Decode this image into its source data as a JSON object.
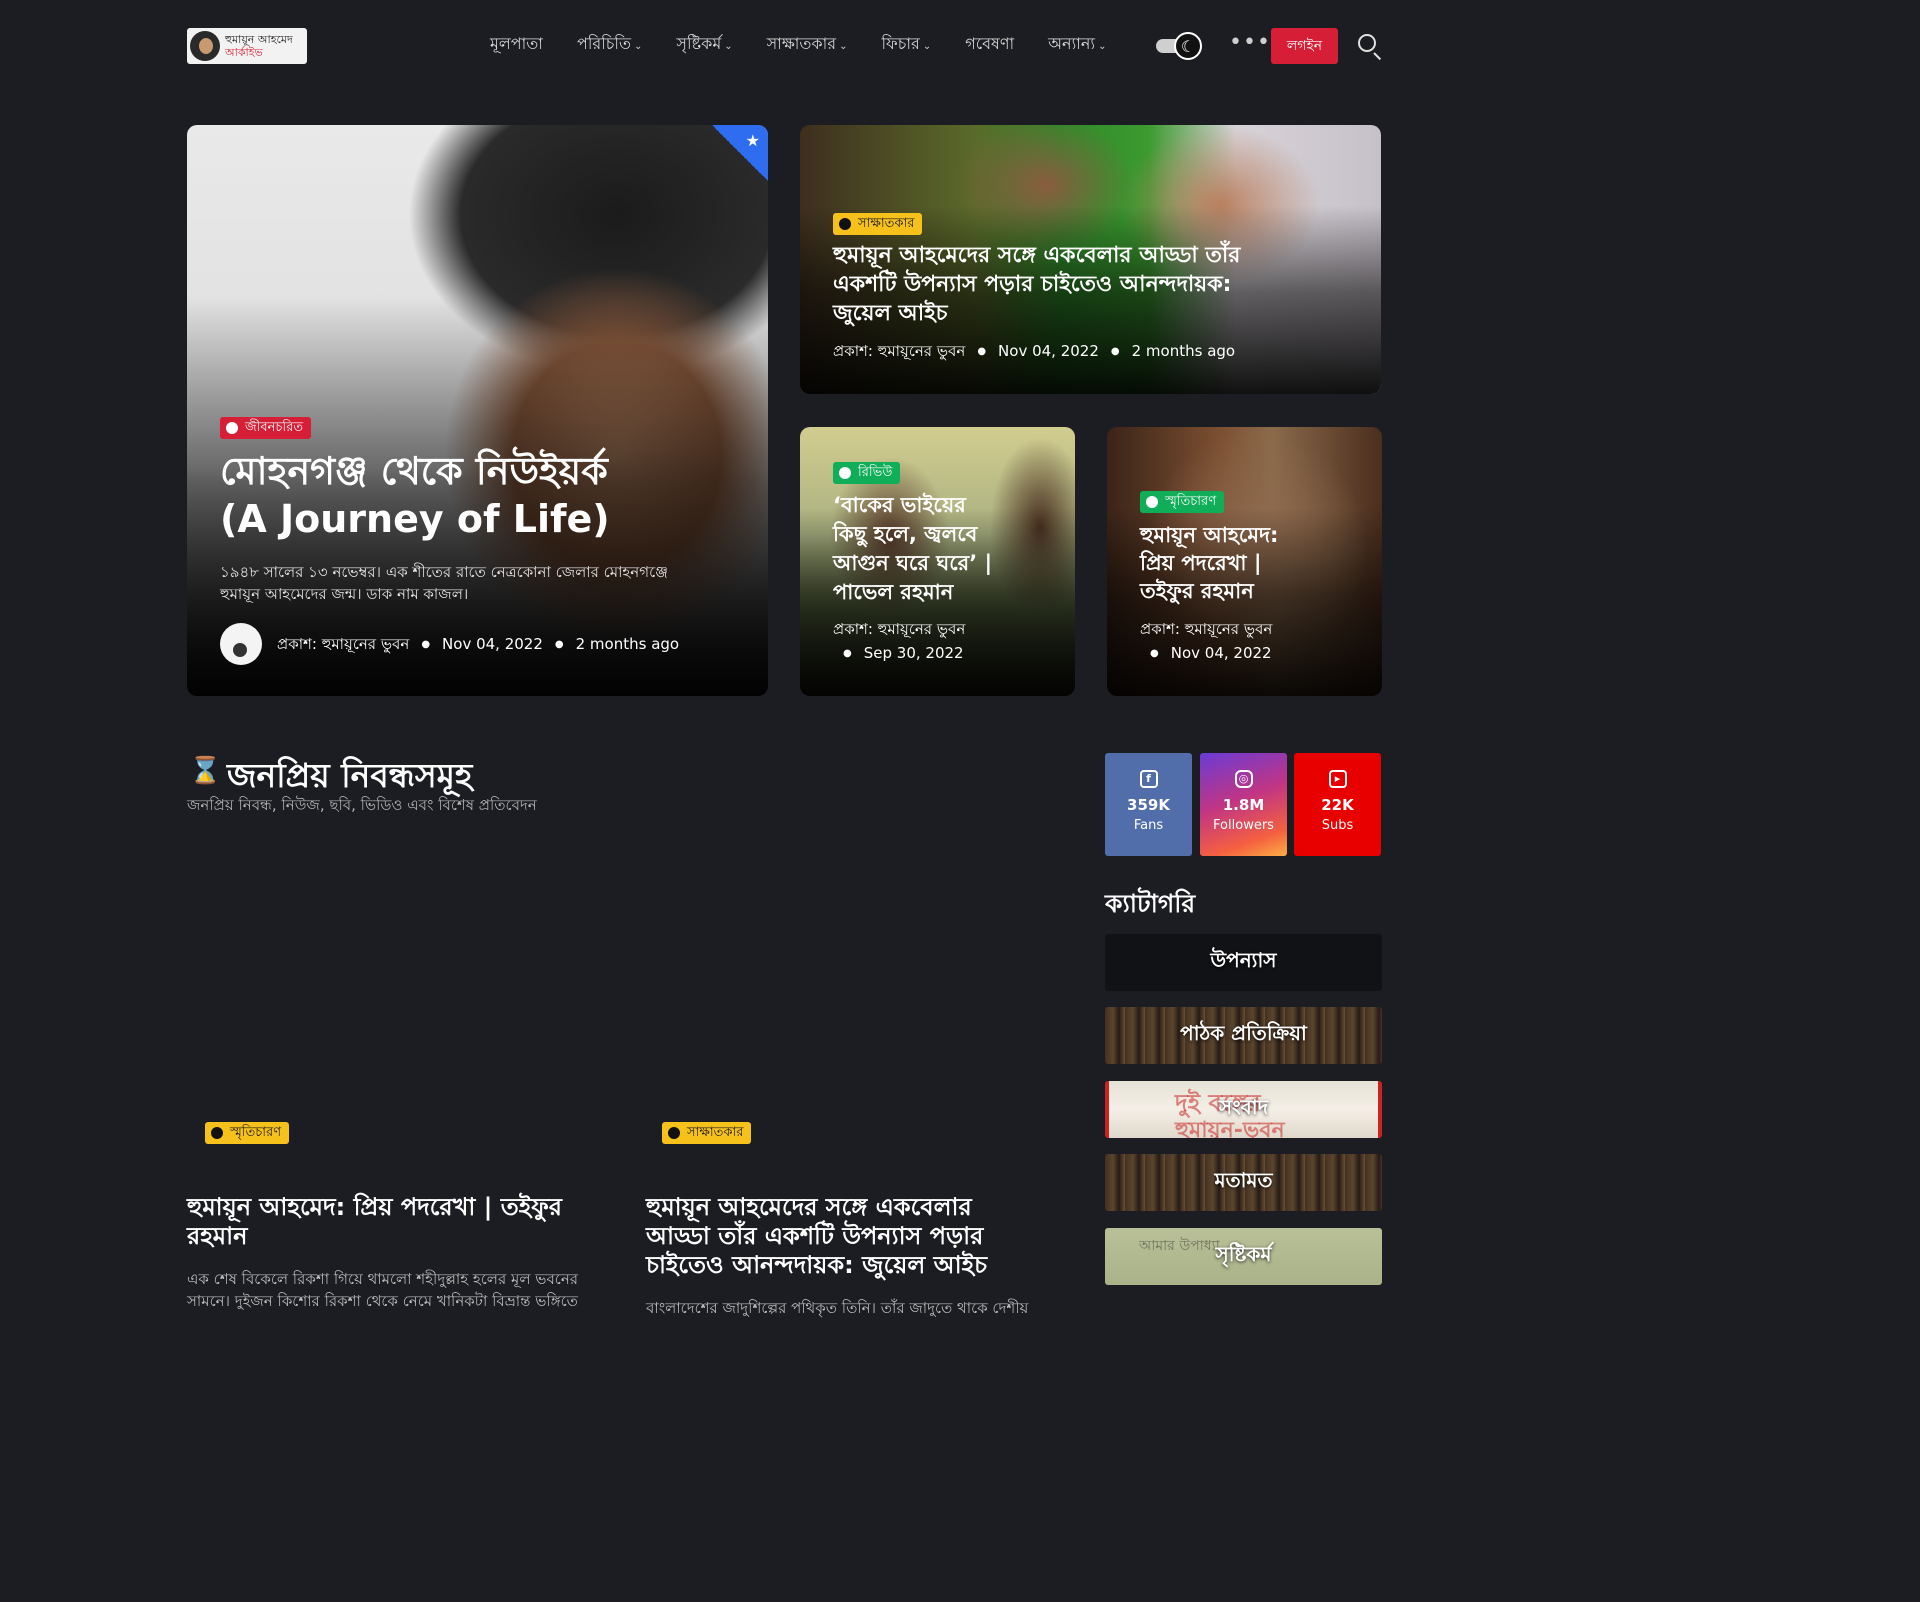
{
  "header": {
    "logo_line1": "হুমায়ূন আহমেদ",
    "logo_line2": "আর্কাইভ",
    "nav": [
      {
        "label": "মূলপাতা",
        "has_dropdown": false
      },
      {
        "label": "পরিচিতি",
        "has_dropdown": true
      },
      {
        "label": "সৃষ্টিকর্ম",
        "has_dropdown": true
      },
      {
        "label": "সাক্ষাতকার",
        "has_dropdown": true
      },
      {
        "label": "ফিচার",
        "has_dropdown": true
      },
      {
        "label": "গবেষণা",
        "has_dropdown": false
      },
      {
        "label": "অন্যান্য",
        "has_dropdown": true
      }
    ],
    "login_label": "লগইন",
    "icons": {
      "theme": "moon-icon",
      "more": "more-dots-icon",
      "search": "search-icon"
    }
  },
  "featured": {
    "main": {
      "category": "জীবনচরিত",
      "title_line1": "মোহনগঞ্জ থেকে নিউইয়র্ক",
      "title_line2": "(A Journey of Life)",
      "excerpt_line1": "১৯৪৮ সালের ১৩ নভেম্বর। এক শীতের রাতে নেত্রকোনা জেলার মোহনগঞ্জে",
      "excerpt_line2": "হুমায়ূন আহমেদের জন্ম। ডাক নাম কাজল।",
      "author": "প্রকাশ: হুমায়ূনের ভুবন",
      "date": "Nov 04, 2022",
      "ago": "2 months ago"
    },
    "top_right": {
      "category": "সাক্ষাতকার",
      "title_line1": "হুমায়ূন আহমেদের সঙ্গে একবেলার আড্ডা তাঁর",
      "title_line2": "একশটি উপন্যাস পড়ার চাইতেও আনন্দদায়ক:",
      "title_line3": "জুয়েল আইচ",
      "author": "প্রকাশ: হুমায়ূনের ভুবন",
      "date": "Nov 04, 2022",
      "ago": "2 months ago"
    },
    "bottom_left": {
      "category": "রিভিউ",
      "title_line1": "‘বাকের ভাইয়ের",
      "title_line2": "কিছু হলে, জ্বলবে",
      "title_line3": "আগুন ঘরে ঘরে’ |",
      "title_line4": "পাভেল রহমান",
      "author": "প্রকাশ: হুমায়ূনের ভুবন",
      "date": "Sep 30, 2022"
    },
    "bottom_right": {
      "category": "স্মৃতিচারণ",
      "title_line1": "হুমায়ূন আহমেদ:",
      "title_line2": "প্রিয় পদরেখা |",
      "title_line3": "তইফুর রহমান",
      "author": "প্রকাশ: হুমায়ূনের ভুবন",
      "date": "Nov 04, 2022"
    }
  },
  "section": {
    "title": "জনপ্রিয় নিবন্ধসমূহ",
    "subtitle": "জনপ্রিয় নিবন্ধ, নিউজ, ছবি, ভিডিও এবং বিশেষ প্রতিবেদন",
    "posts": [
      {
        "category": "স্মৃতিচারণ",
        "title_line1": "হুমায়ূন আহমেদ: প্রিয় পদরেখা | তইফুর",
        "title_line2": "রহমান",
        "excerpt_line1": "এক শেষ বিকেলে রিকশা গিয়ে থামলো শহীদুল্লাহ হলের মূল ভবনের",
        "excerpt_line2": "সামনে। দুইজন কিশোর রিকশা থেকে নেমে খানিকটা বিভ্রান্ত ভঙ্গিতে"
      },
      {
        "category": "সাক্ষাতকার",
        "title_line1": "হুমায়ূন আহমেদের সঙ্গে একবেলার",
        "title_line2": "আড্ডা তাঁর একশটি উপন্যাস পড়ার",
        "title_line3": "চাইতেও আনন্দদায়ক: জুয়েল আইচ",
        "excerpt_line1": "বাংলাদেশের জাদুশিল্পের পথিকৃত তিনি। তাঁর জাদুতে থাকে দেশীয়"
      }
    ]
  },
  "sidebar": {
    "social": [
      {
        "network": "facebook",
        "count": "359K",
        "label": "Fans",
        "color": "#516eab"
      },
      {
        "network": "instagram",
        "count": "1.8M",
        "label": "Followers",
        "color": "#c13584"
      },
      {
        "network": "youtube",
        "count": "22K",
        "label": "Subs",
        "color": "#e80000"
      }
    ],
    "categories_title": "ক্যাটাগরি",
    "categories": [
      "উপন্যাস",
      "পাঠক প্রতিক্রিয়া",
      "সংবাদ",
      "মতামত",
      "সৃষ্টিকর্ম"
    ],
    "paper_text_line1": "দুই বঙ্গের",
    "paper_text_line2": "হুমায়ূন-ভুবন",
    "hand_text": "আমার উপাধ্যা"
  },
  "colors": {
    "background": "#1c1d22",
    "accent": "#d61e36",
    "yellow_badge": "#f6c11b",
    "green_badge": "#11ae5a",
    "ribbon": "#2e6df0"
  }
}
